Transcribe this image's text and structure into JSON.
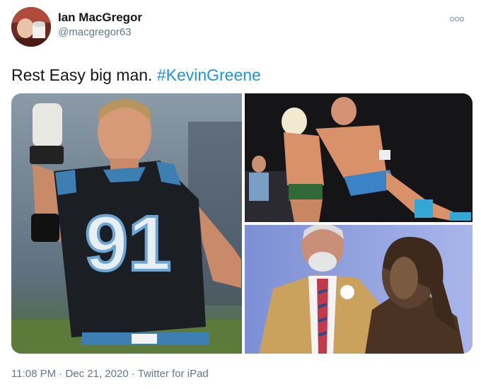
{
  "author": {
    "name": "Ian MacGregor",
    "handle": "@macgregor63"
  },
  "tweet": {
    "text": "Rest Easy big man. ",
    "hashtag": "#KevinGreene"
  },
  "media": {
    "jersey_number": "91",
    "count": 3
  },
  "meta": {
    "time": "11:08 PM",
    "separator": " · ",
    "date": "Dec 21, 2020",
    "source": "Twitter for iPad"
  },
  "colors": {
    "link": "#1b95e0",
    "secondary_text": "#657786",
    "primary_text": "#14171a"
  },
  "icons": [
    "more-options-icon"
  ]
}
